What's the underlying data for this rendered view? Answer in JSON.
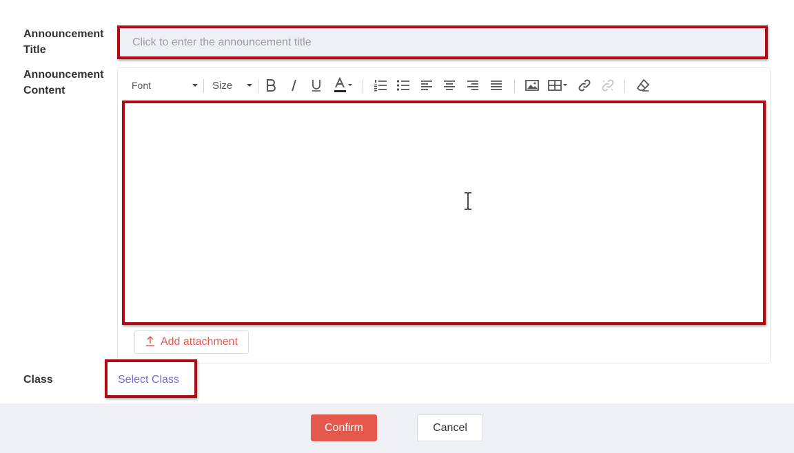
{
  "form": {
    "title_label": "Announcement\nTitle",
    "title_placeholder": "Click to enter the announcement title",
    "content_label": "Announcement\nContent",
    "class_label": "Class",
    "class_select_text": "Select Class"
  },
  "toolbar": {
    "font_label": "Font",
    "size_label": "Size",
    "icons": [
      "bold-icon",
      "italic-icon",
      "underline-icon",
      "font-color-icon",
      "ordered-list-icon",
      "unordered-list-icon",
      "align-left-icon",
      "align-center-icon",
      "align-right-icon",
      "align-justify-icon",
      "image-icon",
      "table-icon",
      "link-icon",
      "unlink-icon",
      "clear-format-icon"
    ]
  },
  "attachment": {
    "label": "Add attachment"
  },
  "footer": {
    "confirm_label": "Confirm",
    "cancel_label": "Cancel"
  },
  "colors": {
    "highlight_border": "#b00b12",
    "primary": "#e5584c",
    "link": "#7b68d8",
    "footer_bg": "#efeff6"
  }
}
